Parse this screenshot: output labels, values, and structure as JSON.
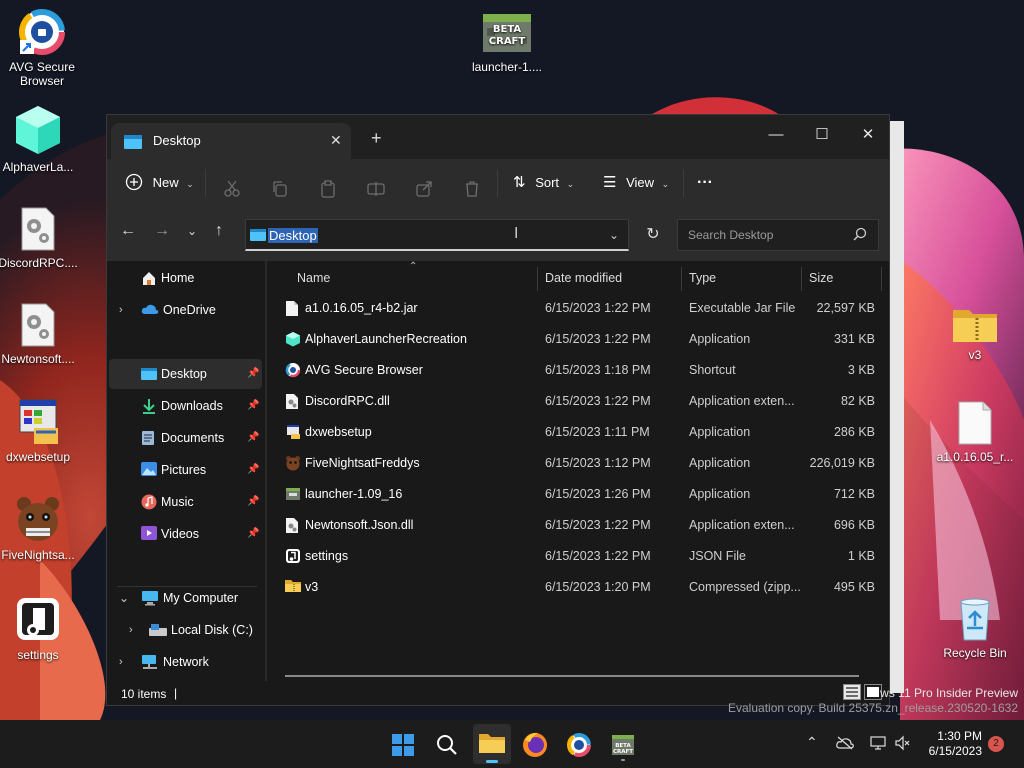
{
  "desktop": {
    "icons": [
      {
        "label": "AVG Secure Browser"
      },
      {
        "label": "AlphaverLa..."
      },
      {
        "label": "DiscordRPC...."
      },
      {
        "label": "Newtonsoft...."
      },
      {
        "label": "dxwebsetup"
      },
      {
        "label": "FiveNightsa..."
      },
      {
        "label": "settings"
      },
      {
        "label": "launcher-1...."
      },
      {
        "label": "v3"
      },
      {
        "label": "a1.0.16.05_r..."
      },
      {
        "label": "Recycle Bin"
      }
    ],
    "launcher_badge": "BETA CRAFT",
    "watermark_line1": "ws 11 Pro Insider Preview",
    "watermark_line2": "Evaluation copy. Build 25375.zn_release.230520-1632"
  },
  "explorer": {
    "tab_title": "Desktop",
    "tab_close": "✕",
    "new_tab": "+",
    "window_controls": {
      "minimize": "—",
      "maximize": "☐",
      "close": "✕"
    },
    "toolbar": {
      "new_label": "New",
      "sort_label": "Sort",
      "view_label": "View",
      "more_label": "···"
    },
    "address": {
      "path": "Desktop",
      "search_placeholder": "Search Desktop"
    },
    "nav": {
      "home": "Home",
      "onedrive": "OneDrive",
      "desktop": "Desktop",
      "downloads": "Downloads",
      "documents": "Documents",
      "pictures": "Pictures",
      "music": "Music",
      "videos": "Videos",
      "my_computer": "My Computer",
      "local_disk": "Local Disk (C:)",
      "network": "Network"
    },
    "columns": {
      "name": "Name",
      "date": "Date modified",
      "type": "Type",
      "size": "Size"
    },
    "files": [
      {
        "name": "a1.0.16.05_r4-b2.jar",
        "date": "6/15/2023 1:22 PM",
        "type": "Executable Jar File",
        "size": "22,597 KB",
        "icon": "file-icon"
      },
      {
        "name": "AlphaverLauncherRecreation",
        "date": "6/15/2023 1:22 PM",
        "type": "Application",
        "size": "331 KB",
        "icon": "cube-icon"
      },
      {
        "name": "AVG Secure Browser",
        "date": "6/15/2023 1:18 PM",
        "type": "Shortcut",
        "size": "3 KB",
        "icon": "avg-browser-icon"
      },
      {
        "name": "DiscordRPC.dll",
        "date": "6/15/2023 1:22 PM",
        "type": "Application exten...",
        "size": "82 KB",
        "icon": "dll-icon"
      },
      {
        "name": "dxwebsetup",
        "date": "6/15/2023 1:11 PM",
        "type": "Application",
        "size": "286 KB",
        "icon": "installer-icon"
      },
      {
        "name": "FiveNightsatFreddys",
        "date": "6/15/2023 1:12 PM",
        "type": "Application",
        "size": "226,019 KB",
        "icon": "freddy-icon"
      },
      {
        "name": "launcher-1.09_16",
        "date": "6/15/2023 1:26 PM",
        "type": "Application",
        "size": "712 KB",
        "icon": "launcher-icon"
      },
      {
        "name": "Newtonsoft.Json.dll",
        "date": "6/15/2023 1:22 PM",
        "type": "Application exten...",
        "size": "696 KB",
        "icon": "dll-icon"
      },
      {
        "name": "settings",
        "date": "6/15/2023 1:22 PM",
        "type": "JSON File",
        "size": "1 KB",
        "icon": "json-icon"
      },
      {
        "name": "v3",
        "date": "6/15/2023 1:20 PM",
        "type": "Compressed (zipp...",
        "size": "495 KB",
        "icon": "zip-folder-icon"
      }
    ],
    "status": {
      "count": "10 items"
    }
  },
  "taskbar": {
    "time": "1:30 PM",
    "date": "6/15/2023",
    "notification_count": "2"
  },
  "colors": {
    "accent": "#2d64b4",
    "window_bg": "#191919",
    "toolbar_bg": "#2c2c2c",
    "folder_blue": "#4fc3f7",
    "folder_yellow": "#f2c14e"
  }
}
